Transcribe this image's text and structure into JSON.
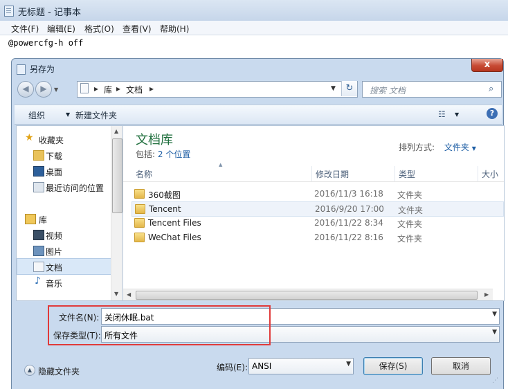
{
  "notepad": {
    "title": "无标题 - 记事本",
    "menu": [
      "文件(F)",
      "编辑(E)",
      "格式(O)",
      "查看(V)",
      "帮助(H)"
    ],
    "content": "@powercfg-h off"
  },
  "dialog": {
    "title": "另存为",
    "close_label": "x",
    "address": {
      "segments": [
        "库",
        "文档"
      ]
    },
    "search_placeholder": "搜索 文档",
    "toolbar": {
      "organize": "组织",
      "new_folder": "新建文件夹"
    },
    "nav": {
      "favorites_label": "收藏夹",
      "favorites": [
        "下载",
        "桌面",
        "最近访问的位置"
      ],
      "libraries_label": "库",
      "libraries": [
        "视频",
        "图片",
        "文档",
        "音乐"
      ]
    },
    "library": {
      "title": "文档库",
      "includes_label": "包括:",
      "includes_link": "2 个位置",
      "arrange_label": "排列方式:",
      "arrange_value": "文件夹"
    },
    "columns": [
      "名称",
      "修改日期",
      "类型",
      "大小"
    ],
    "files": [
      {
        "name": "360截图",
        "date": "2016/11/3 16:18",
        "type": "文件夹"
      },
      {
        "name": "Tencent",
        "date": "2016/9/20 17:00",
        "type": "文件夹"
      },
      {
        "name": "Tencent Files",
        "date": "2016/11/22 8:34",
        "type": "文件夹"
      },
      {
        "name": "WeChat Files",
        "date": "2016/11/22 8:16",
        "type": "文件夹"
      }
    ],
    "filename_label": "文件名(N):",
    "filename_value": "关闭休眠.bat",
    "filetype_label": "保存类型(T):",
    "filetype_value": "所有文件",
    "hide_folders": "隐藏文件夹",
    "encoding_label": "编码(E):",
    "encoding_value": "ANSI",
    "save_button": "保存(S)",
    "cancel_button": "取消"
  }
}
